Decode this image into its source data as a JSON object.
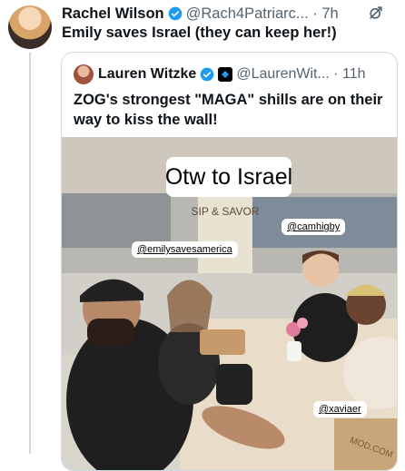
{
  "tweet": {
    "author_name": "Rachel Wilson",
    "handle_time": "@Rach4Patriarc... · 7h",
    "text": "Emily saves Israel (they can keep her!)",
    "menu_icon": "grok-icon"
  },
  "quoted_tweet": {
    "author_name": "Lauren Witzke",
    "handle_time": "@LaurenWit... · 11h",
    "text": "ZOG's strongest \"MAGA\" shills are on their way to kiss the wall!",
    "media": {
      "caption": "Otw to Israel",
      "store_sign": "SIP & SAVOR",
      "bag_text": "MOD.COM",
      "tags": [
        "@emilysavesamerica",
        "@camhigby",
        "@xaviaer"
      ]
    }
  },
  "colors": {
    "verified": "#1d9bf0",
    "secondary_text": "#536471",
    "border": "#cfd9de"
  }
}
